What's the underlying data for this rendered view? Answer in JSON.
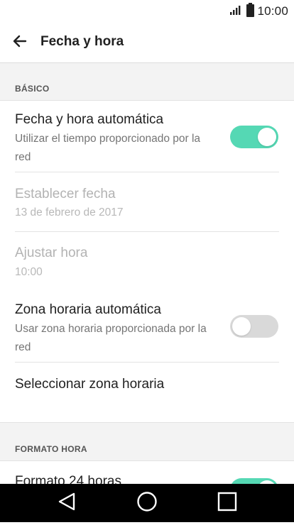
{
  "status_bar": {
    "time": "10:00",
    "signal_icon": "signal-icon",
    "battery_icon": "battery-icon"
  },
  "app_bar": {
    "title": "Fecha y hora",
    "back_icon": "arrow-left-icon"
  },
  "sections": {
    "basic": {
      "header": "BÁSICO"
    },
    "time_format": {
      "header": "FORMATO HORA"
    }
  },
  "settings": {
    "auto_datetime": {
      "title": "Fecha y hora automática",
      "summary": "Utilizar el tiempo proporcionado por la red",
      "enabled": true
    },
    "set_date": {
      "title": "Establecer fecha",
      "summary": "13 de febrero de 2017"
    },
    "set_time": {
      "title": "Ajustar hora",
      "summary": "10:00"
    },
    "auto_timezone": {
      "title": "Zona horaria automática",
      "summary": "Usar zona horaria proporcionada por la red",
      "enabled": false
    },
    "select_timezone": {
      "title": "Seleccionar zona horaria"
    },
    "format_24h": {
      "title": "Formato 24 horas",
      "enabled": true
    }
  },
  "colors": {
    "accent": "#55d8b4",
    "switch_off": "#d9d9d9",
    "section_bg": "#f3f3f3",
    "nav_bar": "#000000"
  },
  "nav_bar": {
    "back_icon": "triangle-back-icon",
    "home_icon": "circle-home-icon",
    "recents_icon": "square-recents-icon"
  }
}
